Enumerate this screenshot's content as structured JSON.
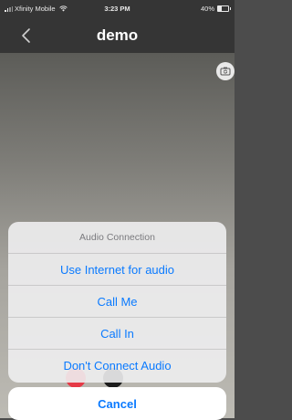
{
  "status_bar": {
    "carrier": "Xfinity Mobile",
    "time": "3:23 PM",
    "battery": "40%",
    "battery_level": 0.4
  },
  "nav": {
    "title": "demo",
    "back_icon": "chevron-left-icon"
  },
  "video": {
    "camera_switch_icon": "camera-switch-icon"
  },
  "action_sheet": {
    "header": "Audio Connection",
    "items": [
      {
        "label": "Use Internet for audio"
      },
      {
        "label": "Call Me"
      },
      {
        "label": "Call In"
      },
      {
        "label": "Don't Connect Audio"
      }
    ],
    "cancel_label": "Cancel"
  },
  "colors": {
    "accent": "#0a7aff",
    "bar_background": "#353535",
    "sheet_background": "#eeeef0"
  }
}
